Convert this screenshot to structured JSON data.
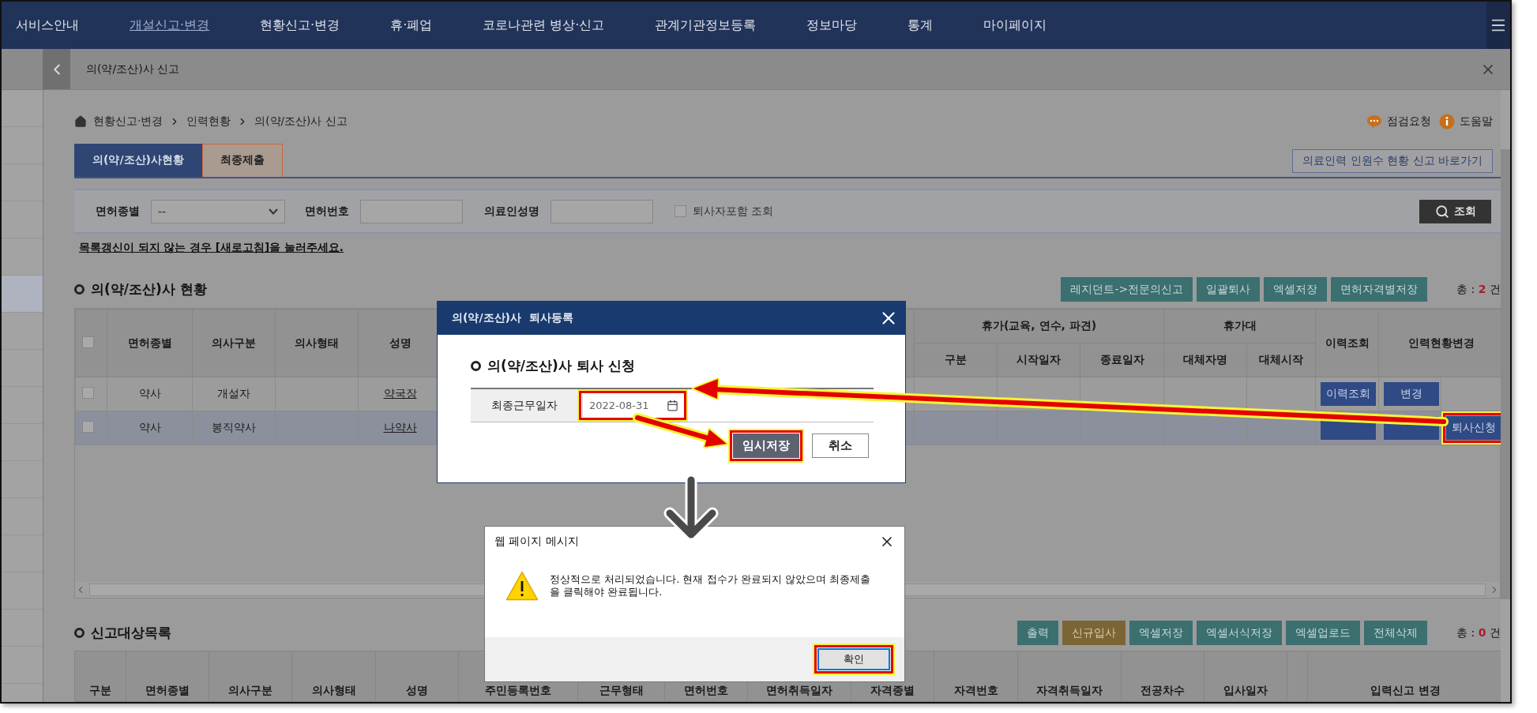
{
  "nav": {
    "items": [
      {
        "label": "서비스안내",
        "selected": false
      },
      {
        "label": "개설신고·변경",
        "selected": true
      },
      {
        "label": "현황신고·변경",
        "selected": false
      },
      {
        "label": "휴·폐업",
        "selected": false
      },
      {
        "label": "코로나관련 병상·신고",
        "selected": false
      },
      {
        "label": "관계기관정보등록",
        "selected": false
      },
      {
        "label": "정보마당",
        "selected": false
      },
      {
        "label": "통계",
        "selected": false
      },
      {
        "label": "마이페이지",
        "selected": false
      }
    ]
  },
  "panel": {
    "title": "의(약/조산)사 신고"
  },
  "sidebar": {
    "items": [
      {
        "selected": false
      },
      {
        "selected": false
      },
      {
        "selected": false
      },
      {
        "selected": false
      },
      {
        "selected": false
      },
      {
        "selected": true
      },
      {
        "selected": false
      },
      {
        "selected": false
      },
      {
        "selected": false
      },
      {
        "selected": false
      },
      {
        "selected": false
      },
      {
        "selected": false
      },
      {
        "selected": false
      },
      {
        "selected": false
      },
      {
        "selected": false
      },
      {
        "selected": false
      }
    ]
  },
  "breadcrumb": [
    "현황신고·변경",
    "인력현황",
    "의(약/조산)사 신고"
  ],
  "header_links": [
    {
      "kind": "inspection",
      "label": "점검요청"
    },
    {
      "kind": "help",
      "label": "도움말"
    }
  ],
  "tabs": [
    {
      "label": "의(약/조산)사현황",
      "selected": true
    },
    {
      "label": "최종제출",
      "selected": false
    }
  ],
  "shortcut_button": "의료인력 인원수 현황 신고 바로가기",
  "filters": {
    "license_type": {
      "label": "면허종별",
      "value": "--"
    },
    "license_number": {
      "label": "면허번호"
    },
    "name": {
      "label": "의료인성명"
    },
    "include_retired": {
      "label": "퇴사자포함 조회",
      "checked": false
    },
    "search_button": "조회"
  },
  "notice": "목록갱신이 되지 않는 경우 [새로고침]을 눌러주세요.",
  "staff_section": {
    "title": "의(약/조산)사 현황",
    "buttons": [
      "레지던트->전문의신고",
      "일괄퇴사",
      "엑셀저장",
      "면허자격별저장"
    ],
    "total": {
      "label": "총 :",
      "count": "2",
      "unit": "건"
    },
    "table": {
      "select_all_checked": false,
      "columns_before": [
        "면허종별",
        "의사구분",
        "의사형태",
        "성명"
      ],
      "groups": [
        {
          "label": "휴가(교육, 연수, 파견)",
          "columns": [
            "구분",
            "시작일자",
            "종료일자"
          ]
        },
        {
          "label": "휴가대",
          "columns": [
            "대체자명",
            "대체시작"
          ]
        }
      ],
      "columns_after": [
        "이력조회",
        "인력현황변경"
      ],
      "rows": [
        {
          "checked": false,
          "selected": false,
          "license_type": "약사",
          "category": "개설자",
          "name": "약국장",
          "actions": [
            {
              "label": "이력조회",
              "highlighted": false
            },
            {
              "label": "변경",
              "highlighted": false
            }
          ]
        },
        {
          "checked": false,
          "selected": true,
          "license_type": "약사",
          "category": "봉직약사",
          "name": "나약사",
          "actions": [
            {
              "highlighted": false
            },
            {
              "highlighted": false
            },
            {
              "label": "퇴사신청",
              "highlighted": true
            }
          ]
        }
      ]
    }
  },
  "report_section": {
    "title": "신고대상목록",
    "buttons": [
      {
        "label": "출력",
        "kind": "normal"
      },
      {
        "label": "신규입사",
        "kind": "accent"
      },
      {
        "label": "엑셀저장",
        "kind": "normal"
      },
      {
        "label": "엑셀서식저장",
        "kind": "normal"
      },
      {
        "label": "엑셀업로드",
        "kind": "normal"
      },
      {
        "label": "전체삭제",
        "kind": "normal"
      }
    ],
    "total": {
      "label": "총 :",
      "count": "0",
      "unit": "건"
    },
    "columns": [
      {
        "kind": "text",
        "label": "구분"
      },
      {
        "kind": "text",
        "label": "면허종별"
      },
      {
        "kind": "text",
        "label": "의사구분"
      },
      {
        "kind": "text",
        "label": "의사형태"
      },
      {
        "kind": "text",
        "label": "성명"
      },
      {
        "kind": "text",
        "label": "주민등록번호"
      },
      {
        "kind": "text",
        "label": "근무형태"
      },
      {
        "kind": "text",
        "label": "면허번호"
      },
      {
        "kind": "text",
        "label": "면허취득일자"
      },
      {
        "kind": "text",
        "label": "자격종별"
      },
      {
        "kind": "text",
        "label": "자격번호"
      },
      {
        "kind": "text",
        "label": "자격취득일자"
      },
      {
        "kind": "text",
        "label": "전공차수"
      },
      {
        "kind": "text",
        "label": "입사일자"
      },
      {
        "kind": "clipped"
      },
      {
        "kind": "text",
        "label": "입력신고 변경"
      }
    ]
  },
  "retire_dialog": {
    "title": "의(약/조산)사  퇴사등록",
    "section_title": "의(약/조산)사 퇴사 신청",
    "field": {
      "label": "최종근무일자",
      "value": "2022-08-31",
      "highlighted": true
    },
    "buttons": [
      {
        "label": "임시저장",
        "kind": "primary",
        "highlighted": true
      },
      {
        "label": "취소",
        "kind": "secondary",
        "highlighted": false
      }
    ]
  },
  "message_dialog": {
    "title": "웹 페이지 메시지",
    "message": "정상적으로 처리되었습니다. 현재 접수가 완료되지 않았으며 최종제출을 클릭해야 완료됩니다.",
    "button": {
      "label": "확인",
      "highlighted": true
    }
  }
}
